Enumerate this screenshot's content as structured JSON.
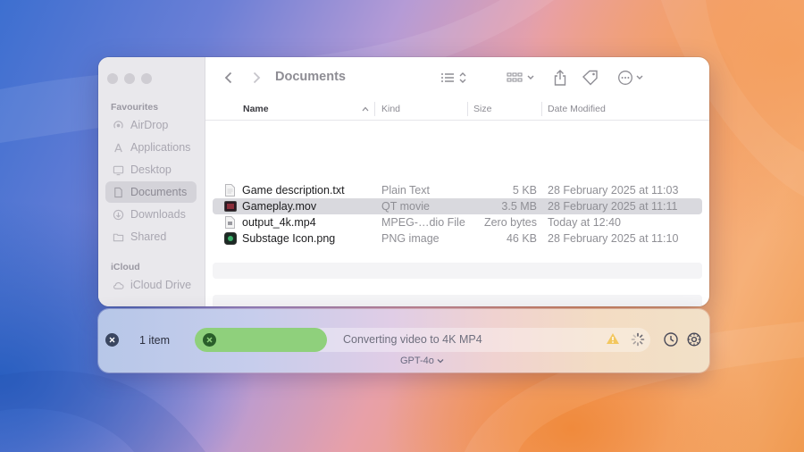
{
  "finder": {
    "title": "Documents",
    "sidebar": {
      "favourites_label": "Favourites",
      "icloud_label": "iCloud",
      "items": [
        {
          "label": "AirDrop",
          "icon": "airdrop-icon"
        },
        {
          "label": "Applications",
          "icon": "applications-icon"
        },
        {
          "label": "Desktop",
          "icon": "desktop-icon"
        },
        {
          "label": "Documents",
          "icon": "documents-icon",
          "active": true
        },
        {
          "label": "Downloads",
          "icon": "downloads-icon"
        },
        {
          "label": "Shared",
          "icon": "shared-folder-icon"
        }
      ],
      "icloud_items": [
        {
          "label": "iCloud Drive",
          "icon": "icloud-icon"
        }
      ]
    },
    "columns": {
      "name": "Name",
      "kind": "Kind",
      "size": "Size",
      "date": "Date Modified"
    },
    "files": [
      {
        "name": "Game description.txt",
        "kind": "Plain Text",
        "size": "5 KB",
        "date": "28 February 2025 at 11:03",
        "icon": "text-file-icon"
      },
      {
        "name": "Gameplay.mov",
        "kind": "QT movie",
        "size": "3.5 MB",
        "date": "28 February 2025 at 11:11",
        "icon": "movie-file-icon",
        "selected": true
      },
      {
        "name": "output_4k.mp4",
        "kind": "MPEG-…dio File",
        "size": "Zero bytes",
        "date": "Today at 12:40",
        "icon": "video-file-icon"
      },
      {
        "name": "Substage Icon.png",
        "kind": "PNG image",
        "size": "46 KB",
        "date": "28 February 2025 at 11:10",
        "icon": "image-file-icon"
      }
    ]
  },
  "assistant": {
    "item_count": "1 item",
    "status": "Converting video to 4K MP4",
    "model": "GPT-4o",
    "progress": 0.29
  },
  "colors": {
    "progress_green": "#8fd07c",
    "selection": "#d9d9de"
  }
}
